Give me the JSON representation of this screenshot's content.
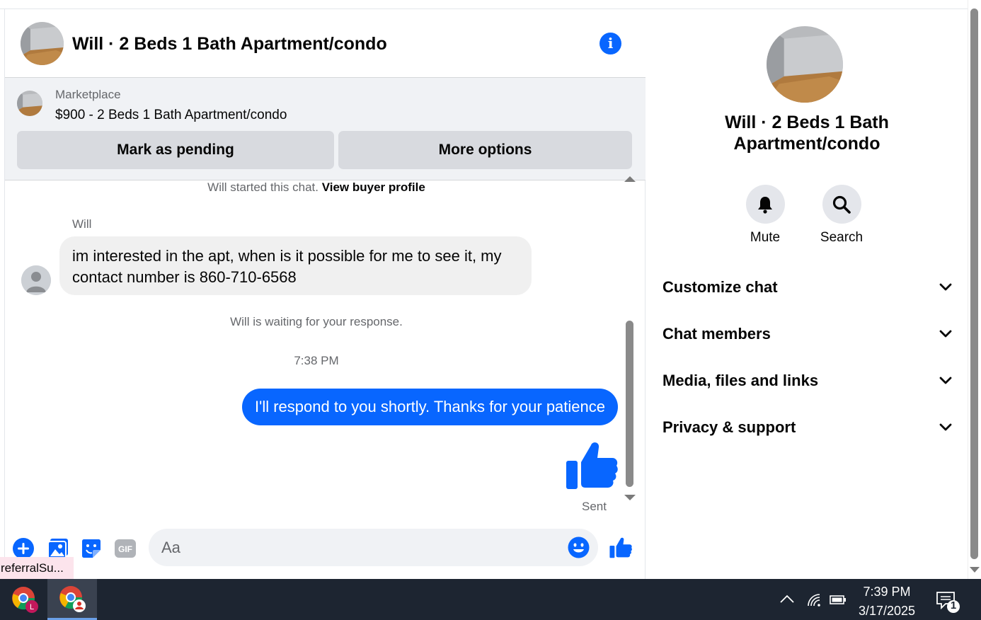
{
  "chat": {
    "title": "Will · 2 Beds 1 Bath Apartment/condo",
    "marketplace": {
      "label": "Marketplace",
      "item": "$900 - 2 Beds 1 Bath Apartment/condo",
      "buttons": {
        "pending": "Mark as pending",
        "options": "More options"
      }
    },
    "started_text": "Will started this chat.",
    "buyer_profile_link": "View buyer profile",
    "sender_name": "Will",
    "incoming_message": "im interested in the apt, when is it possible for me to see it, my contact number is 860-710-6568",
    "waiting_text": "Will is waiting for your response.",
    "timestamp": "7:38 PM",
    "outgoing_message": "I'll respond to you shortly. Thanks for your patience",
    "sent_status": "Sent",
    "composer_placeholder": "Aa"
  },
  "tooltip": "referralSu...",
  "side": {
    "title": "Will · 2 Beds 1 Bath Apartment/condo",
    "actions": {
      "mute": "Mute",
      "search": "Search"
    },
    "sections": [
      "Customize chat",
      "Chat members",
      "Media, files and links",
      "Privacy & support"
    ]
  },
  "taskbar": {
    "time": "7:39 PM",
    "date": "3/17/2025",
    "notification_count": "1",
    "badge_letter": "L"
  },
  "colors": {
    "accent": "#0866ff",
    "taskbar": "#1d2531"
  }
}
